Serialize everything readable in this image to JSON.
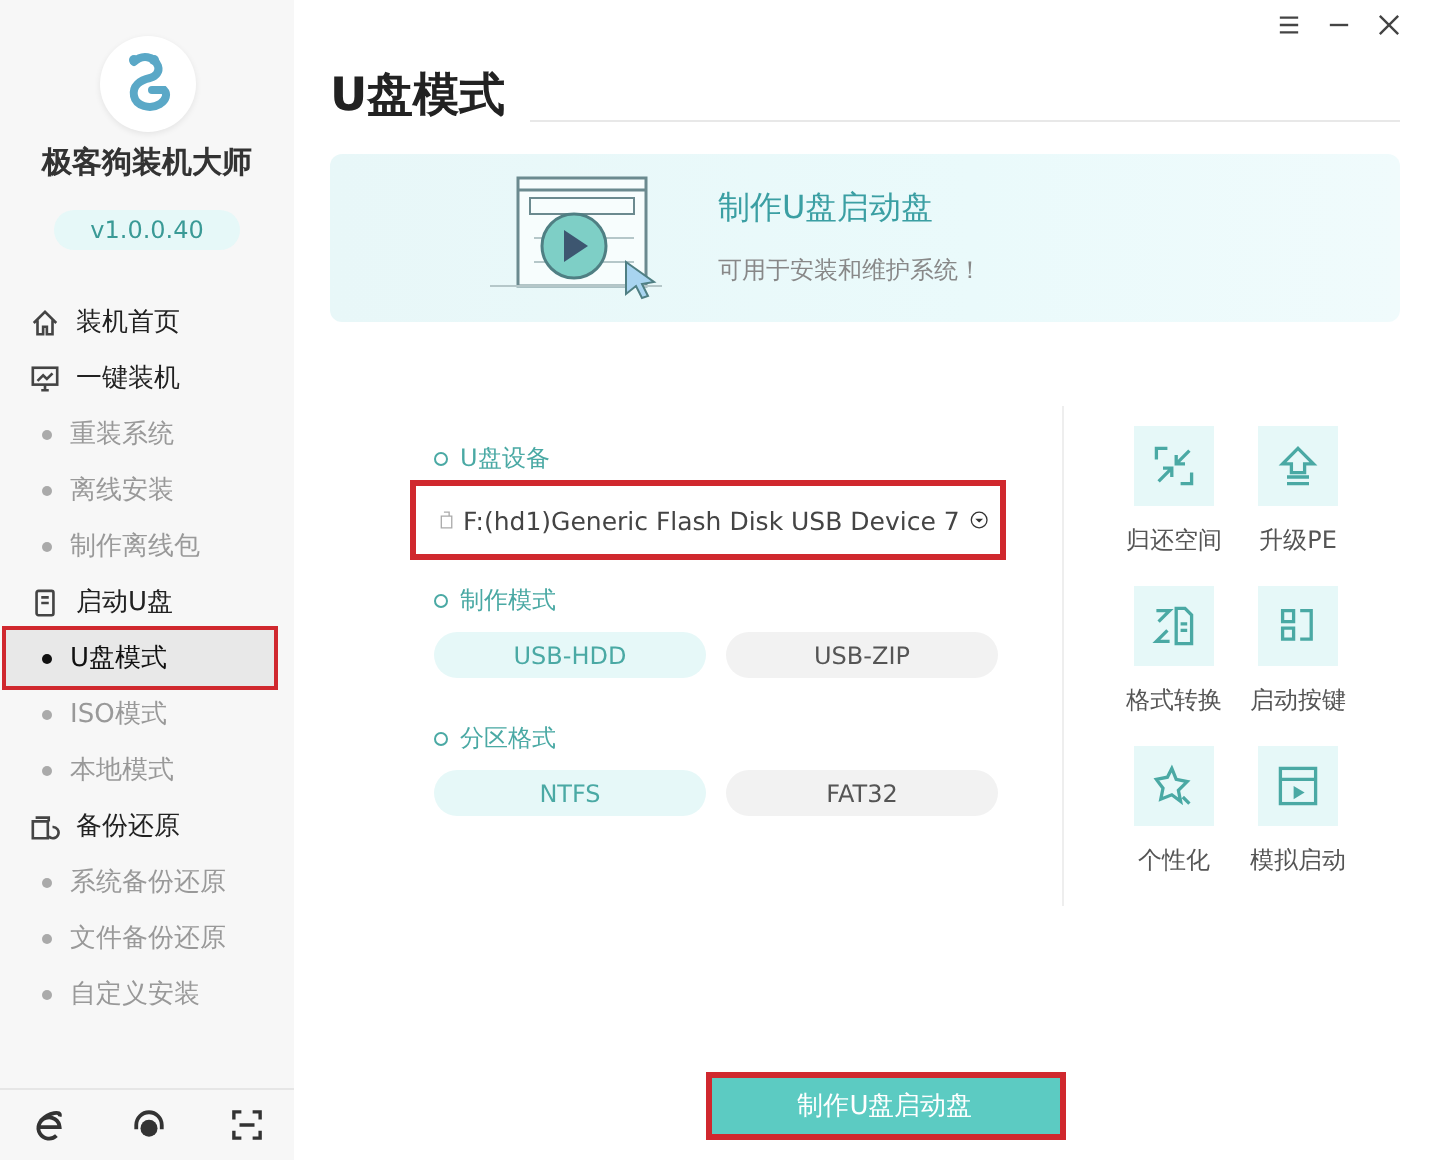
{
  "app": {
    "name": "极客狗装机大师",
    "version": "v1.0.0.40"
  },
  "sidebar": {
    "items": [
      {
        "label": "装机首页",
        "selected": false,
        "highlighted": false
      },
      {
        "label": "一键装机",
        "selected": false,
        "highlighted": false,
        "children": [
          {
            "label": "重装系统",
            "selected": false,
            "highlighted": false
          },
          {
            "label": "离线安装",
            "selected": false,
            "highlighted": false
          },
          {
            "label": "制作离线包",
            "selected": false,
            "highlighted": false
          }
        ]
      },
      {
        "label": "启动U盘",
        "selected": false,
        "highlighted": false,
        "children": [
          {
            "label": "U盘模式",
            "selected": true,
            "highlighted": true
          },
          {
            "label": "ISO模式",
            "selected": false,
            "highlighted": false
          },
          {
            "label": "本地模式",
            "selected": false,
            "highlighted": false
          }
        ]
      },
      {
        "label": "备份还原",
        "selected": false,
        "highlighted": false,
        "children": [
          {
            "label": "系统备份还原",
            "selected": false,
            "highlighted": false
          },
          {
            "label": "文件备份还原",
            "selected": false,
            "highlighted": false
          },
          {
            "label": "自定义安装",
            "selected": false,
            "highlighted": false
          }
        ]
      }
    ]
  },
  "page_title": "U盘模式",
  "banner": {
    "title": "制作U盘启动盘",
    "subtitle": "可用于安装和维护系统！"
  },
  "device": {
    "label": "U盘设备",
    "value": "F:(hd1)Generic Flash Disk USB Device 7",
    "highlighted": true
  },
  "mode": {
    "label": "制作模式",
    "options": [
      {
        "label": "USB-HDD",
        "selected": true
      },
      {
        "label": "USB-ZIP",
        "selected": false
      }
    ]
  },
  "partition": {
    "label": "分区格式",
    "options": [
      {
        "label": "NTFS",
        "selected": true
      },
      {
        "label": "FAT32",
        "selected": false
      }
    ]
  },
  "tools": [
    {
      "label": "归还空间"
    },
    {
      "label": "升级PE"
    },
    {
      "label": "格式转换"
    },
    {
      "label": "启动按键"
    },
    {
      "label": "个性化"
    },
    {
      "label": "模拟启动"
    }
  ],
  "make_button": {
    "label": "制作U盘启动盘",
    "highlighted": true
  }
}
